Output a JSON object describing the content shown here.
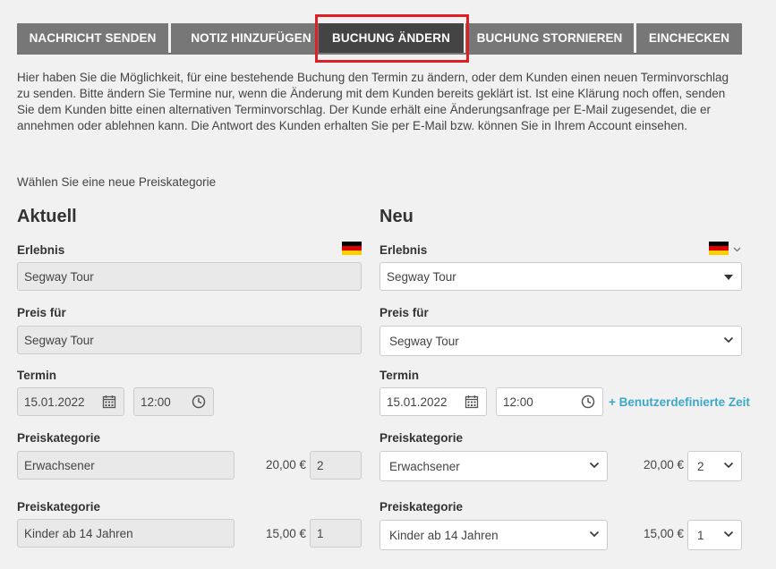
{
  "tabs": [
    {
      "label": "NACHRICHT SENDEN",
      "active": false
    },
    {
      "label": "NOTIZ HINZUFÜGEN",
      "active": false
    },
    {
      "label": "BUCHUNG ÄNDERN",
      "active": true
    },
    {
      "label": "BUCHUNG STORNIEREN",
      "active": false
    },
    {
      "label": "EINCHECKEN",
      "active": false
    }
  ],
  "intro_text": "Hier haben Sie die Möglichkeit, für eine bestehende Buchung den Termin zu ändern, oder dem Kunden einen neuen Terminvorschlag zu senden. Bitte ändern Sie Termine nur, wenn die Änderung mit dem Kunden bereits geklärt ist. Ist eine Klärung noch offen, senden Sie dem Kunden bitte einen alternativen Terminvorschlag. Der Kunde erhält eine Änderungsanfrage per E-Mail zugesendet, die er annehmen oder ablehnen kann. Die Antwort des Kunden erhalten Sie per E-Mail bzw. können Sie in Ihrem Account einsehen.",
  "choose_category_label": "Wählen Sie eine neue Preiskategorie",
  "current": {
    "title": "Aktuell",
    "experience_label": "Erlebnis",
    "experience_value": "Segway Tour",
    "price_for_label": "Preis für",
    "price_for_value": "Segway Tour",
    "date_label": "Termin",
    "date_value": "15.01.2022",
    "time_value": "12:00",
    "categories": [
      {
        "label": "Preiskategorie",
        "value": "Erwachsener",
        "price": "20,00 €",
        "qty": "2"
      },
      {
        "label": "Preiskategorie",
        "value": "Kinder ab 14 Jahren",
        "price": "15,00 €",
        "qty": "1"
      }
    ]
  },
  "new": {
    "title": "Neu",
    "experience_label": "Erlebnis",
    "experience_value": "Segway Tour",
    "price_for_label": "Preis für",
    "price_for_value": "Segway Tour",
    "date_label": "Termin",
    "date_value": "15.01.2022",
    "time_value": "12:00",
    "custom_time_link": "+ Benutzerdefinierte Zeit",
    "categories": [
      {
        "label": "Preiskategorie",
        "value": "Erwachsener",
        "price": "20,00 €",
        "qty": "2"
      },
      {
        "label": "Preiskategorie",
        "value": "Kinder ab 14 Jahren",
        "price": "15,00 €",
        "qty": "1"
      }
    ]
  },
  "colors": {
    "tab_bg": "#777777",
    "tab_active_bg": "#444444",
    "highlight": "#e01e26",
    "link": "#3ba8c8"
  },
  "icons": {
    "language_flag": "german-flag-icon",
    "calendar": "calendar-icon",
    "clock": "clock-icon",
    "dropdown": "chevron-down-icon"
  }
}
